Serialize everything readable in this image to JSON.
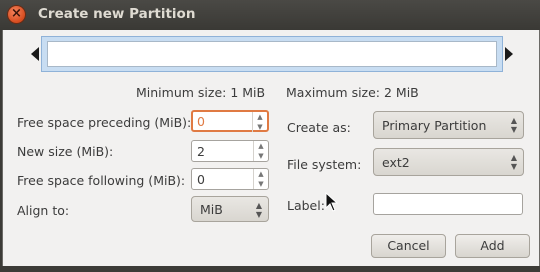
{
  "window": {
    "title": "Create new Partition"
  },
  "sizes": {
    "minimum": "Minimum size: 1 MiB",
    "maximum": "Maximum size: 2 MiB"
  },
  "fields": {
    "free_before_label": "Free space preceding (MiB):",
    "free_before_value": "0",
    "new_size_label": "New size (MiB):",
    "new_size_value": "2",
    "free_after_label": "Free space following (MiB):",
    "free_after_value": "0",
    "align_label": "Align to:",
    "align_value": "MiB",
    "create_as_label": "Create as:",
    "create_as_value": "Primary Partition",
    "filesystem_label": "File system:",
    "filesystem_value": "ext2",
    "partition_label_label": "Label:",
    "partition_label_value": ""
  },
  "buttons": {
    "cancel": "Cancel",
    "add": "Add"
  },
  "icons": {
    "close": "close-icon",
    "cursor": "mouse-pointer-icon"
  }
}
